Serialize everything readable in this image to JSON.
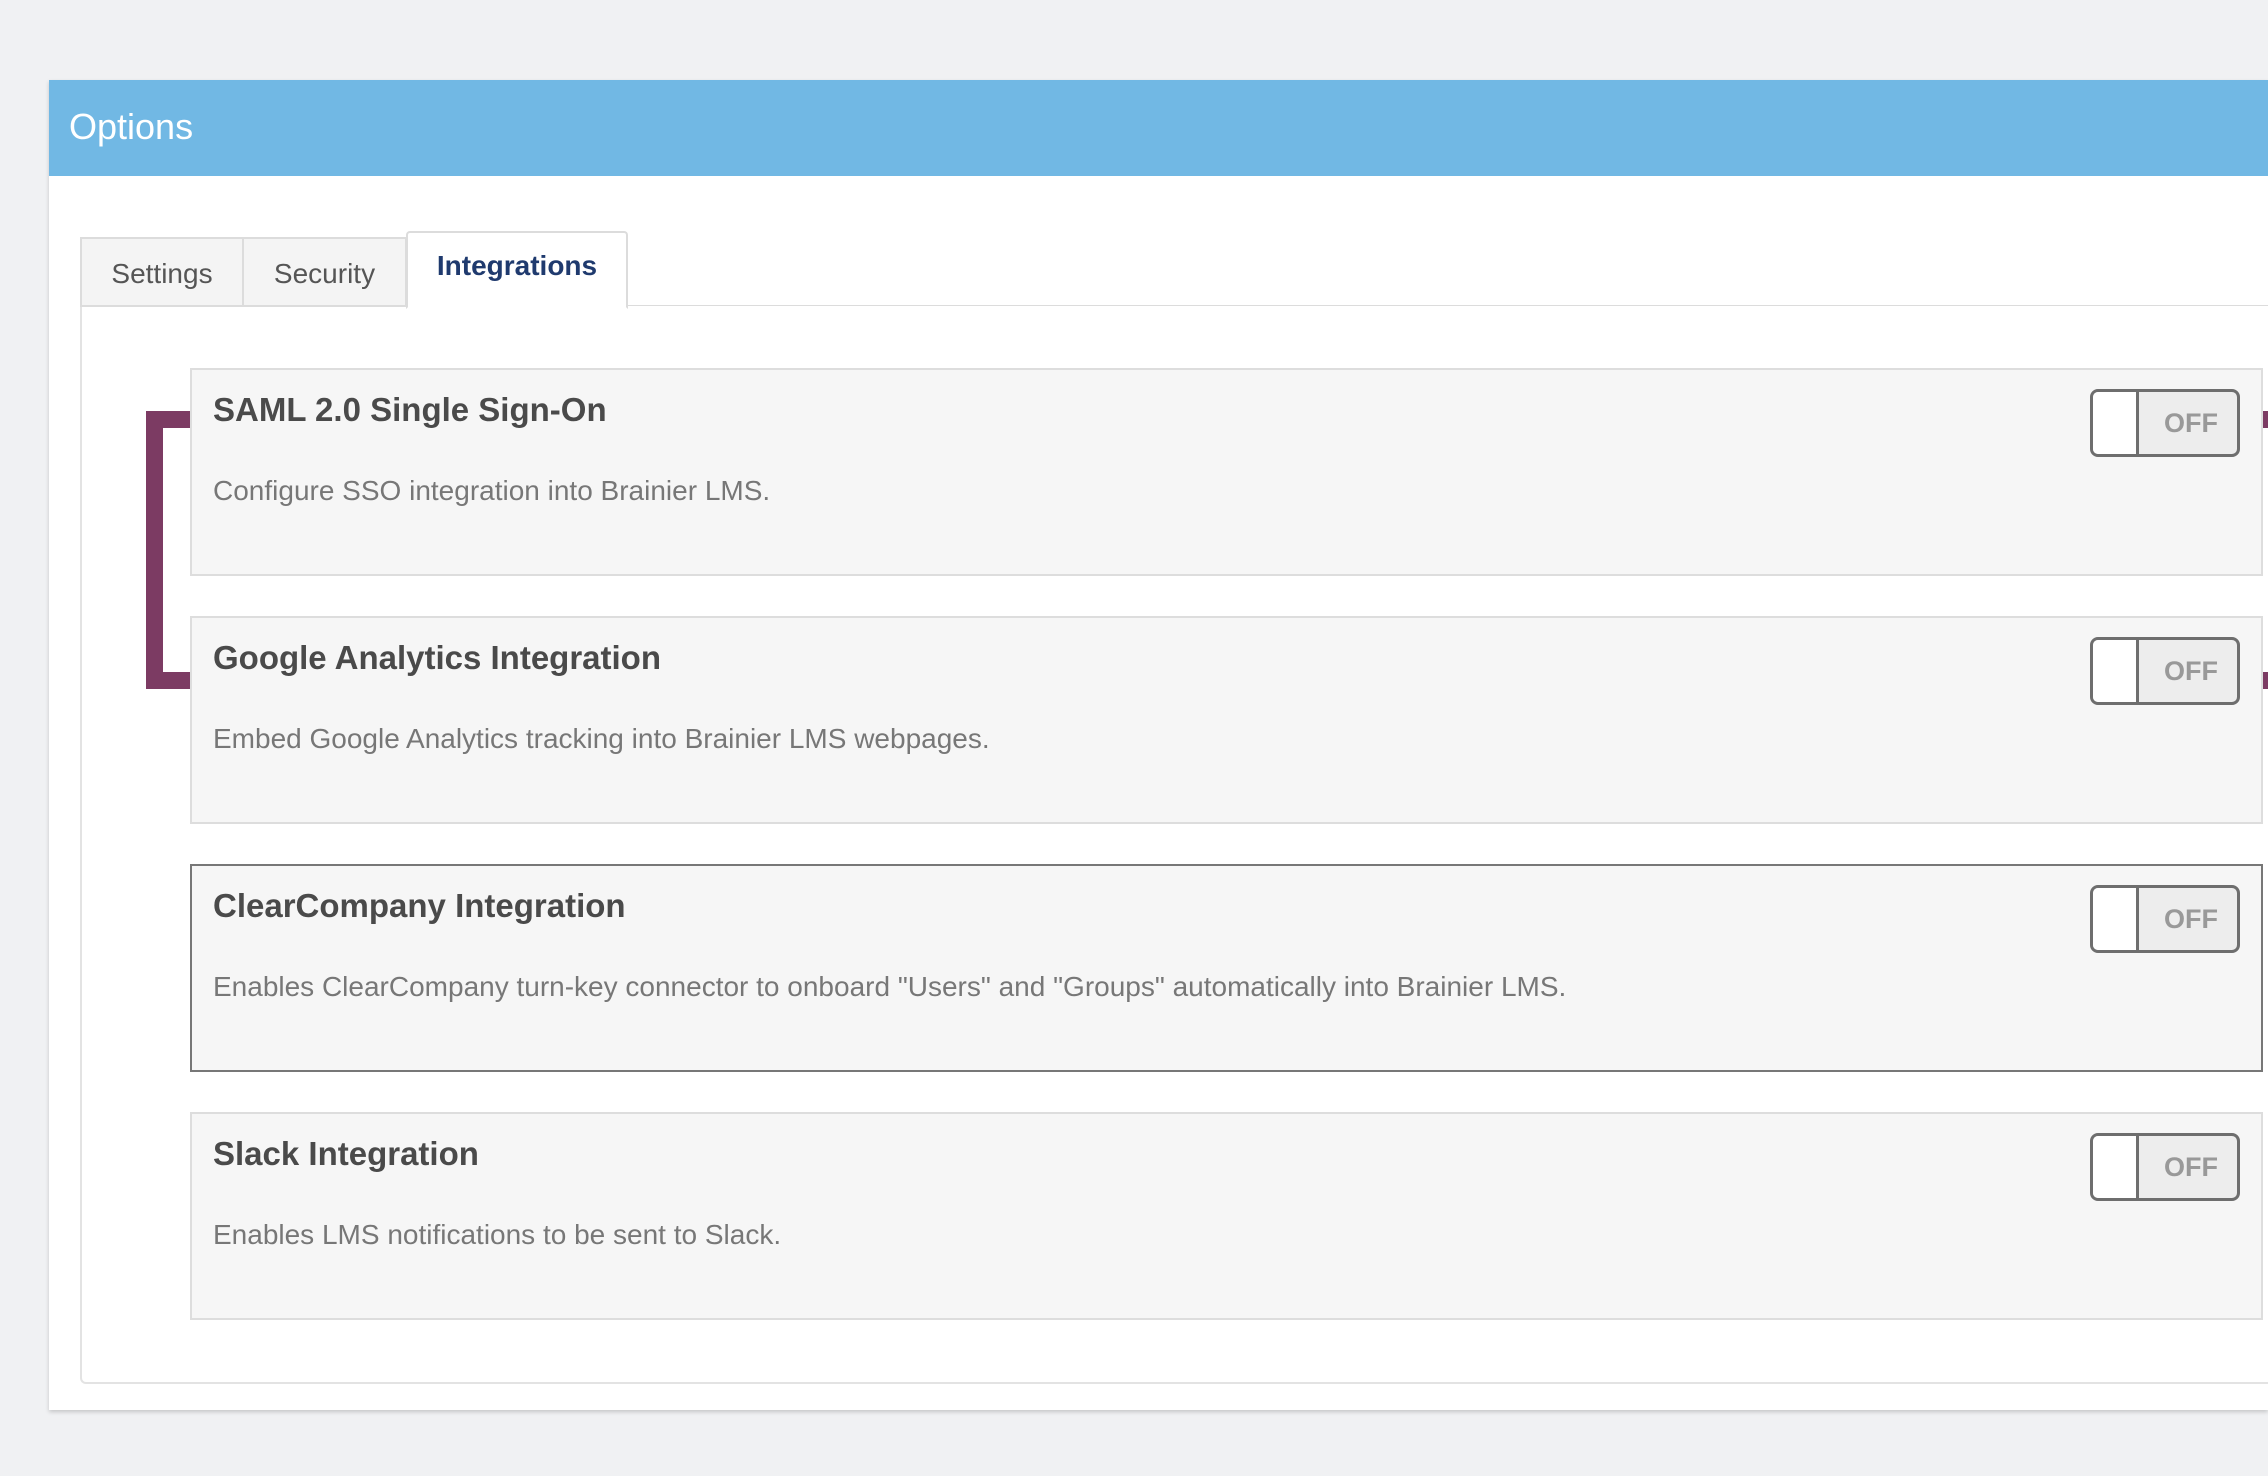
{
  "panel": {
    "title": "Options"
  },
  "tabs": [
    {
      "label": "Settings",
      "active": false
    },
    {
      "label": "Security",
      "active": false
    },
    {
      "label": "Integrations",
      "active": true
    }
  ],
  "integrations": [
    {
      "title": "SAML 2.0 Single Sign-On",
      "description": "Configure SSO integration into Brainier LMS.",
      "toggle_label": "OFF",
      "enabled": false,
      "highlighted": true
    },
    {
      "title": "Google Analytics Integration",
      "description": "Embed Google Analytics tracking into Brainier LMS webpages.",
      "toggle_label": "OFF",
      "enabled": false,
      "highlighted": false
    },
    {
      "title": "ClearCompany Integration",
      "description": "Enables ClearCompany turn-key connector to onboard \"Users\" and \"Groups\" automatically into Brainier LMS.",
      "toggle_label": "OFF",
      "enabled": false,
      "highlighted": false
    },
    {
      "title": "Slack Integration",
      "description": "Enables LMS notifications to be sent to Slack.",
      "toggle_label": "OFF",
      "enabled": false,
      "highlighted": false
    }
  ],
  "colors": {
    "header": "#71b8e4",
    "highlight": "#7c3b63",
    "active_tab_text": "#1f3a6e"
  }
}
